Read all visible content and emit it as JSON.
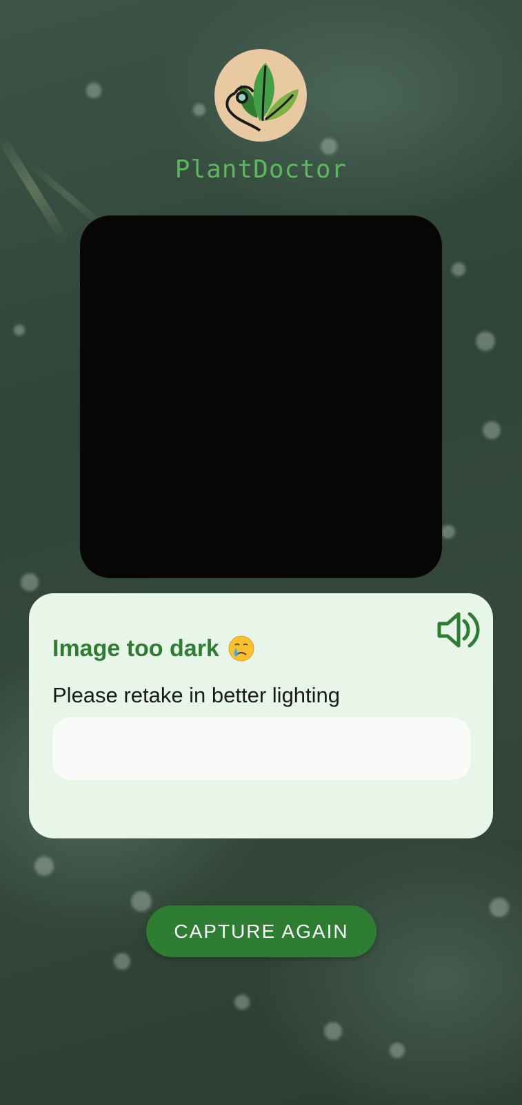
{
  "app": {
    "name": "PlantDoctor",
    "logo_icon": "plant-doctor-logo-icon"
  },
  "result": {
    "title": "Image too dark",
    "title_emoji": "crying-face-emoji",
    "message": "Please retake in better lighting",
    "details": "",
    "speaker_icon": "speaker-icon"
  },
  "actions": {
    "capture_again_label": "CAPTURE AGAIN"
  },
  "colors": {
    "brand_green": "#2e7d32",
    "app_name_green": "#5cb85c",
    "card_background": "#e8f5e9",
    "logo_background": "#e9c9a2",
    "preview_background": "#080507"
  }
}
